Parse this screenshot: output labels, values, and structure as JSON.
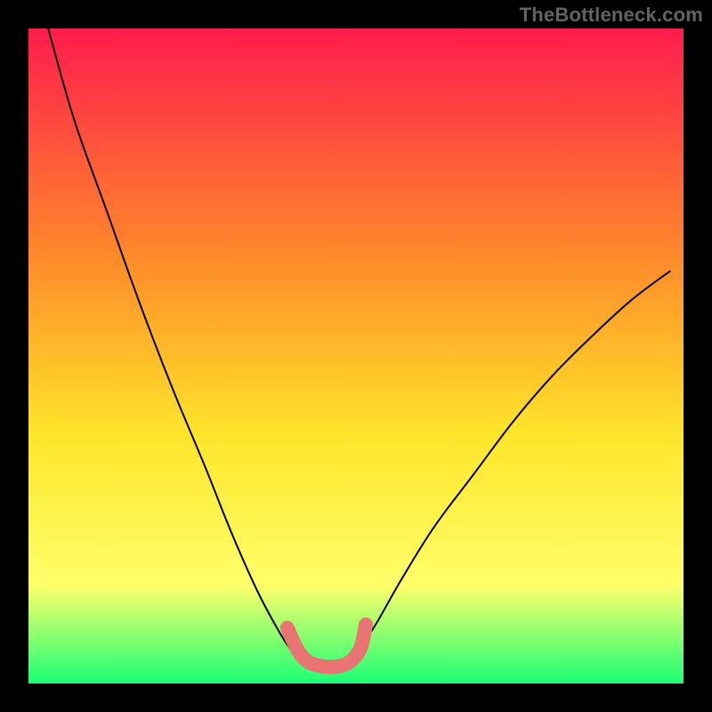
{
  "watermark": "TheBottleneck.com",
  "chart_data": {
    "type": "line",
    "title": "",
    "xlabel": "",
    "ylabel": "",
    "xlim": [
      0,
      1
    ],
    "ylim": [
      0,
      1
    ],
    "background_gradient": {
      "top": "#ff1c4d",
      "mid1": "#ff8a2a",
      "mid2": "#ffe52a",
      "mid3": "#ffff6a",
      "bottom": "#1aff76"
    },
    "series": [
      {
        "name": "left-curve",
        "x": [
          0.03,
          0.07,
          0.12,
          0.17,
          0.22,
          0.27,
          0.31,
          0.35,
          0.385,
          0.405
        ],
        "y": [
          1.0,
          0.86,
          0.72,
          0.58,
          0.45,
          0.33,
          0.23,
          0.14,
          0.075,
          0.045
        ],
        "stroke": "#000000",
        "width": 2
      },
      {
        "name": "right-curve",
        "x": [
          0.5,
          0.53,
          0.57,
          0.62,
          0.68,
          0.74,
          0.8,
          0.86,
          0.92,
          0.98
        ],
        "y": [
          0.045,
          0.09,
          0.16,
          0.24,
          0.32,
          0.4,
          0.47,
          0.53,
          0.585,
          0.63
        ],
        "stroke": "#000000",
        "width": 2
      },
      {
        "name": "pink-marker",
        "x": [
          0.395,
          0.415,
          0.44,
          0.48,
          0.505,
          0.515
        ],
        "y": [
          0.085,
          0.045,
          0.028,
          0.028,
          0.05,
          0.09
        ],
        "stroke": "#e97474",
        "width": 16,
        "cap": "round"
      }
    ]
  }
}
